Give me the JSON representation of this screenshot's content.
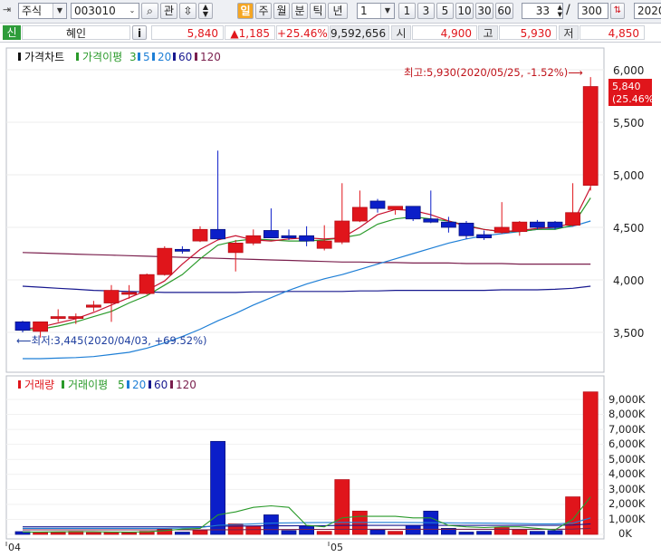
{
  "toolbar": {
    "market": "주식",
    "code": "003010",
    "watch_label": "관",
    "period_tabs": [
      "일",
      "주",
      "월",
      "분",
      "틱",
      "년"
    ],
    "interval_select": "1",
    "interval_buttons": [
      "1",
      "3",
      "5",
      "10",
      "30",
      "60"
    ],
    "view_count": "33",
    "separator": "/",
    "total_count": "300",
    "date_value": "2020/"
  },
  "info": {
    "credit_badge": "신",
    "stock_name": "혜인",
    "info_button": "i",
    "price": "5,840",
    "change": "▲1,185",
    "change_pct": "+25.46%",
    "volume": "9,592,656",
    "open_label": "시",
    "open": "4,900",
    "high_label": "고",
    "high": "5,930",
    "low_label": "저",
    "low": "4,850"
  },
  "price_panel": {
    "legend": {
      "chart_label": "가격차트",
      "ma_label": "가격이평",
      "periods": [
        "3",
        "5",
        "20",
        "60",
        "120"
      ]
    },
    "high_note": "최고:5,930(2020/05/25, -1.52%)⟶",
    "low_note": "⟵최저:3,445(2020/04/03, +69.52%)",
    "current_price_label": "5,840",
    "current_pct_label": "(25.46%)",
    "y_ticks": [
      "6,000",
      "5,500",
      "5,000",
      "4,500",
      "4,000",
      "3,500"
    ]
  },
  "volume_panel": {
    "legend": {
      "chart_label": "거래량",
      "ma_label": "거래이평",
      "periods": [
        "5",
        "20",
        "60",
        "120"
      ]
    },
    "y_ticks": [
      "9,000K",
      "8,000K",
      "7,000K",
      "6,000K",
      "5,000K",
      "4,000K",
      "3,000K",
      "2,000K",
      "1,000K",
      "0K"
    ]
  },
  "x_axis": {
    "ticks": [
      "04",
      "05"
    ]
  },
  "colors": {
    "up": "#e0151b",
    "down": "#0b1ec9",
    "ma3": "#c8102e",
    "ma5": "#2a9a2a",
    "ma20": "#1e7fd6",
    "ma60": "#17188f",
    "ma120": "#7a1f4d"
  },
  "chart_data": [
    {
      "type": "candlestick",
      "title": "가격차트",
      "ylim": [
        3200,
        6150
      ],
      "x_ticks": [
        "04",
        "05"
      ],
      "candles": [
        {
          "o": 3600,
          "h": 3610,
          "l": 3500,
          "c": 3520
        },
        {
          "o": 3510,
          "h": 3600,
          "l": 3450,
          "c": 3600
        },
        {
          "o": 3640,
          "h": 3720,
          "l": 3600,
          "c": 3650
        },
        {
          "o": 3640,
          "h": 3680,
          "l": 3580,
          "c": 3650
        },
        {
          "o": 3740,
          "h": 3800,
          "l": 3700,
          "c": 3760
        },
        {
          "o": 3780,
          "h": 3950,
          "l": 3600,
          "c": 3900
        },
        {
          "o": 3870,
          "h": 3950,
          "l": 3820,
          "c": 3880
        },
        {
          "o": 3870,
          "h": 4060,
          "l": 3860,
          "c": 4050
        },
        {
          "o": 4050,
          "h": 4320,
          "l": 4040,
          "c": 4300
        },
        {
          "o": 4290,
          "h": 4320,
          "l": 4250,
          "c": 4280
        },
        {
          "o": 4370,
          "h": 4510,
          "l": 4360,
          "c": 4480
        },
        {
          "o": 4480,
          "h": 5230,
          "l": 4380,
          "c": 4390
        },
        {
          "o": 4260,
          "h": 4380,
          "l": 4080,
          "c": 4350
        },
        {
          "o": 4350,
          "h": 4480,
          "l": 4330,
          "c": 4420
        },
        {
          "o": 4470,
          "h": 4680,
          "l": 4400,
          "c": 4400
        },
        {
          "o": 4420,
          "h": 4480,
          "l": 4380,
          "c": 4400
        },
        {
          "o": 4420,
          "h": 4510,
          "l": 4320,
          "c": 4370
        },
        {
          "o": 4300,
          "h": 4520,
          "l": 4280,
          "c": 4370
        },
        {
          "o": 4360,
          "h": 4920,
          "l": 4340,
          "c": 4560
        },
        {
          "o": 4560,
          "h": 4850,
          "l": 4550,
          "c": 4690
        },
        {
          "o": 4750,
          "h": 4770,
          "l": 4640,
          "c": 4680
        },
        {
          "o": 4670,
          "h": 4700,
          "l": 4620,
          "c": 4700
        },
        {
          "o": 4700,
          "h": 4700,
          "l": 4560,
          "c": 4580
        },
        {
          "o": 4580,
          "h": 4850,
          "l": 4540,
          "c": 4550
        },
        {
          "o": 4550,
          "h": 4600,
          "l": 4450,
          "c": 4500
        },
        {
          "o": 4540,
          "h": 4560,
          "l": 4390,
          "c": 4420
        },
        {
          "o": 4430,
          "h": 4470,
          "l": 4380,
          "c": 4400
        },
        {
          "o": 4450,
          "h": 4740,
          "l": 4440,
          "c": 4500
        },
        {
          "o": 4460,
          "h": 4560,
          "l": 4420,
          "c": 4550
        },
        {
          "o": 4550,
          "h": 4570,
          "l": 4480,
          "c": 4500
        },
        {
          "o": 4550,
          "h": 4560,
          "l": 4480,
          "c": 4500
        },
        {
          "o": 4520,
          "h": 4920,
          "l": 4510,
          "c": 4640
        },
        {
          "o": 4900,
          "h": 5930,
          "l": 4850,
          "c": 5840
        }
      ],
      "ma3": [
        3530,
        3550,
        3590,
        3630,
        3690,
        3760,
        3830,
        3900,
        3990,
        4150,
        4290,
        4380,
        4420,
        4380,
        4370,
        4390,
        4400,
        4390,
        4400,
        4500,
        4620,
        4670,
        4660,
        4620,
        4560,
        4510,
        4480,
        4460,
        4470,
        4490,
        4500,
        4540,
        4880
      ],
      "ma5": [
        3520,
        3530,
        3560,
        3600,
        3650,
        3700,
        3780,
        3850,
        3950,
        4050,
        4200,
        4330,
        4370,
        4390,
        4380,
        4370,
        4370,
        4380,
        4400,
        4430,
        4530,
        4580,
        4600,
        4580,
        4560,
        4520,
        4480,
        4460,
        4460,
        4480,
        4480,
        4520,
        4780
      ],
      "ma20": [
        3250,
        3250,
        3255,
        3260,
        3270,
        3290,
        3310,
        3350,
        3400,
        3460,
        3530,
        3610,
        3680,
        3760,
        3830,
        3900,
        3960,
        4010,
        4050,
        4100,
        4150,
        4200,
        4250,
        4300,
        4350,
        4390,
        4420,
        4440,
        4460,
        4480,
        4490,
        4510,
        4560
      ],
      "ma60": [
        3940,
        3930,
        3920,
        3910,
        3900,
        3895,
        3890,
        3885,
        3880,
        3880,
        3880,
        3880,
        3880,
        3885,
        3885,
        3890,
        3890,
        3890,
        3890,
        3895,
        3895,
        3900,
        3900,
        3900,
        3900,
        3900,
        3900,
        3905,
        3905,
        3905,
        3910,
        3920,
        3940
      ],
      "ma120": [
        4260,
        4255,
        4250,
        4245,
        4240,
        4235,
        4230,
        4225,
        4220,
        4215,
        4210,
        4205,
        4200,
        4195,
        4190,
        4185,
        4180,
        4175,
        4170,
        4170,
        4165,
        4165,
        4160,
        4160,
        4160,
        4155,
        4155,
        4155,
        4150,
        4150,
        4150,
        4150,
        4150
      ]
    },
    {
      "type": "bar",
      "title": "거래량",
      "ylim": [
        0,
        9800
      ],
      "unit": "K",
      "values": [
        180,
        150,
        130,
        200,
        120,
        150,
        100,
        200,
        350,
        150,
        250,
        6200,
        700,
        550,
        1300,
        250,
        550,
        200,
        3650,
        1550,
        300,
        200,
        600,
        1550,
        400,
        150,
        200,
        450,
        300,
        200,
        250,
        2500,
        9500
      ],
      "ma5": [
        150,
        160,
        170,
        180,
        180,
        160,
        150,
        170,
        250,
        350,
        400,
        1300,
        1500,
        1800,
        1900,
        1800,
        600,
        500,
        1100,
        1200,
        1200,
        1200,
        1100,
        1100,
        600,
        500,
        450,
        500,
        500,
        400,
        300,
        1000,
        2500
      ],
      "ma20": [
        400,
        400,
        400,
        400,
        400,
        400,
        400,
        400,
        400,
        420,
        450,
        600,
        650,
        700,
        750,
        770,
        780,
        790,
        800,
        800,
        800,
        800,
        790,
        780,
        770,
        760,
        750,
        740,
        720,
        700,
        700,
        750,
        1100
      ],
      "ma60": [
        500,
        500,
        500,
        500,
        500,
        500,
        500,
        500,
        500,
        500,
        500,
        550,
        550,
        560,
        570,
        570,
        580,
        580,
        600,
        600,
        600,
        600,
        600,
        600,
        600,
        600,
        600,
        600,
        600,
        600,
        600,
        620,
        700
      ],
      "ma120": [
        300,
        300,
        300,
        300,
        300,
        300,
        300,
        300,
        300,
        300,
        300,
        310,
        310,
        320,
        320,
        320,
        330,
        330,
        340,
        340,
        340,
        340,
        340,
        340,
        340,
        340,
        340,
        340,
        340,
        340,
        340,
        350,
        400
      ]
    }
  ]
}
